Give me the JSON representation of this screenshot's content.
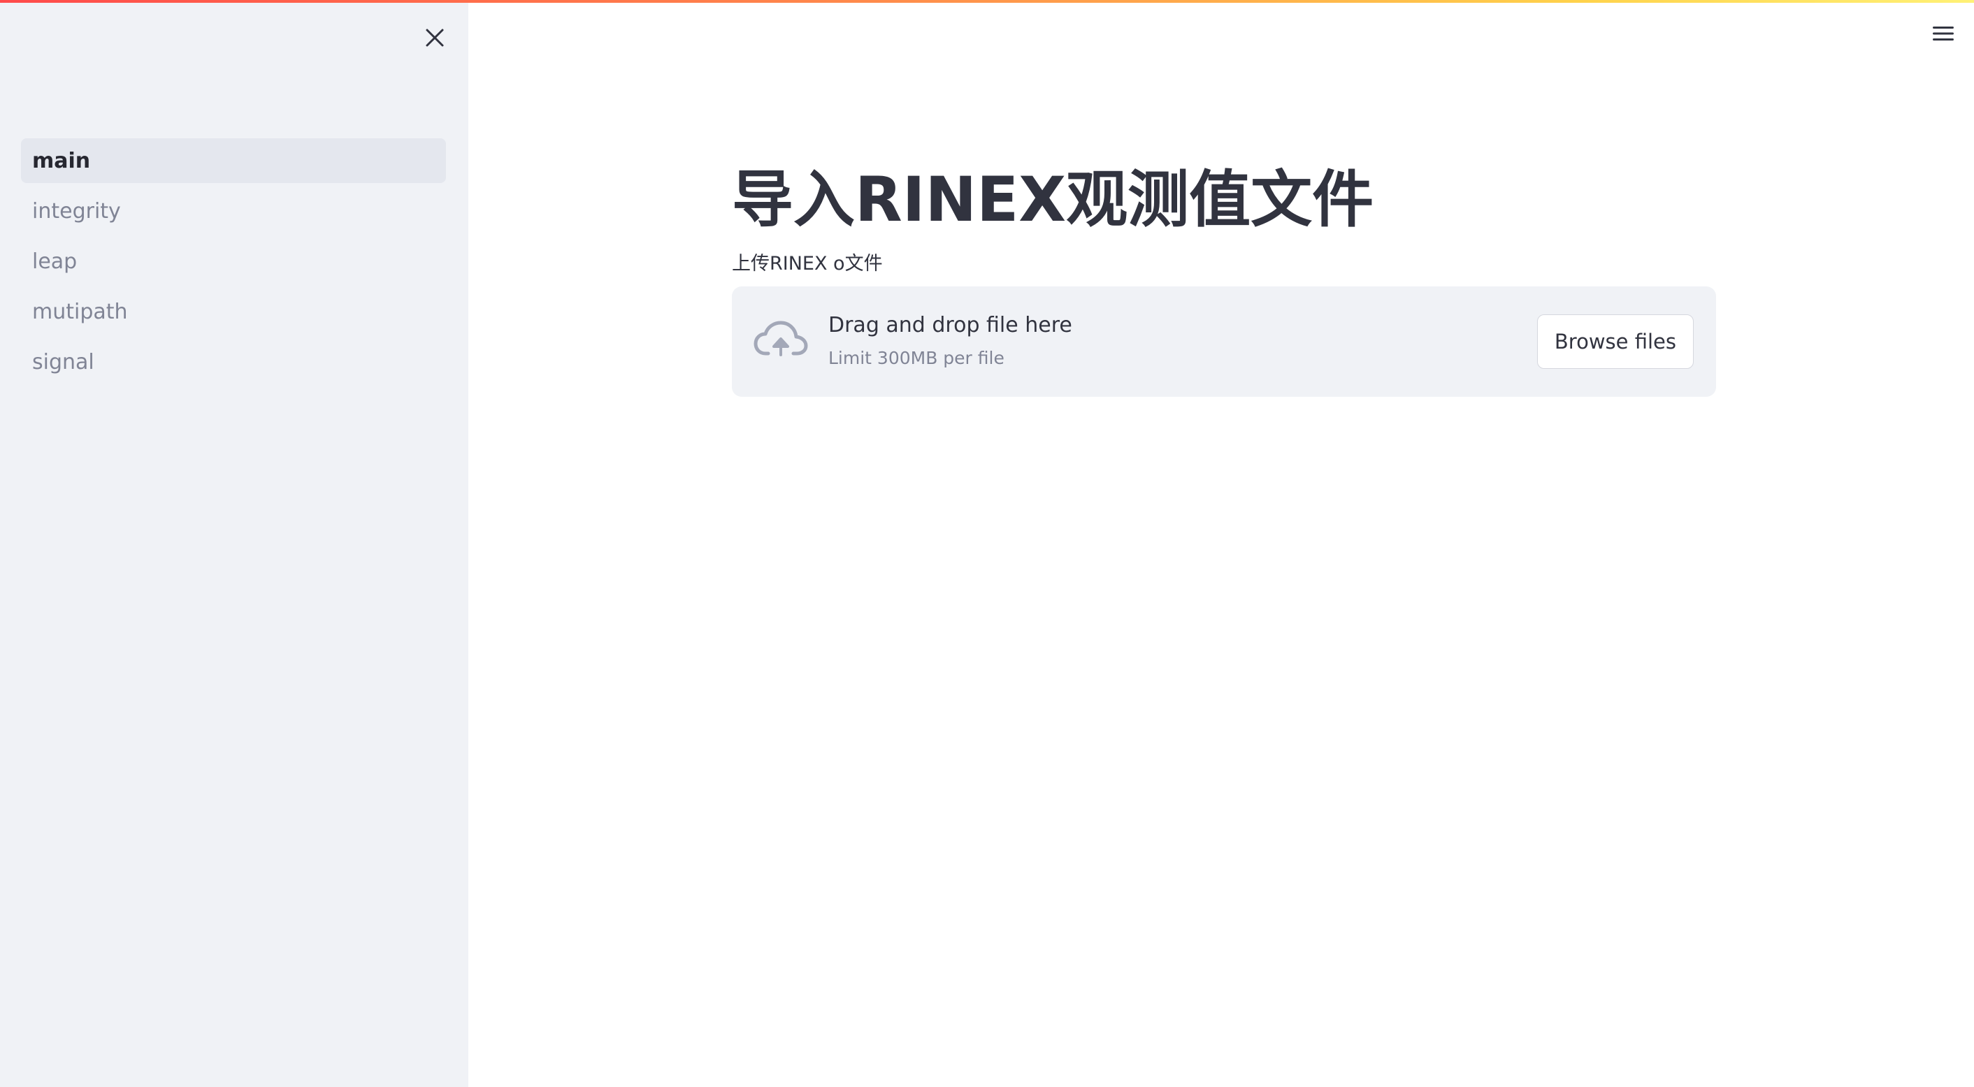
{
  "sidebar": {
    "close_icon": "close-icon",
    "items": [
      {
        "label": "main",
        "active": true
      },
      {
        "label": "integrity",
        "active": false
      },
      {
        "label": "leap",
        "active": false
      },
      {
        "label": "mutipath",
        "active": false
      },
      {
        "label": "signal",
        "active": false
      }
    ]
  },
  "header": {
    "menu_icon": "hamburger-menu-icon",
    "accent_gradient": [
      "#ff4b4b",
      "#ffd24b"
    ]
  },
  "main": {
    "title": "导入RINEX观测值文件",
    "uploader": {
      "label": "上传RINEX o文件",
      "icon": "cloud-upload-icon",
      "drop_text": "Drag and drop file here",
      "limit_text": "Limit 300MB per file",
      "browse_label": "Browse files"
    }
  },
  "colors": {
    "sidebar_bg": "#f0f2f6",
    "active_item_bg": "#e4e7ee",
    "text": "#31333f",
    "muted_text": "#808495"
  }
}
